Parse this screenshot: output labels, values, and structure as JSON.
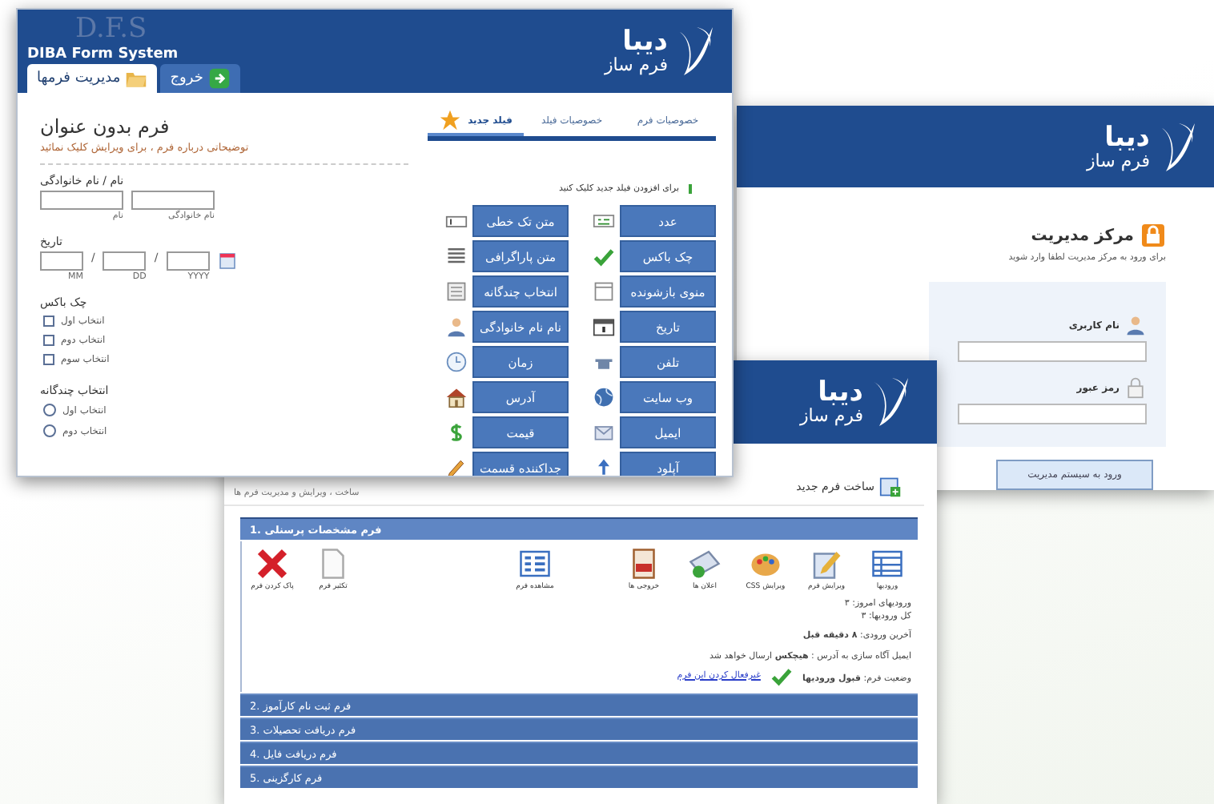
{
  "form_editor": {
    "brand": "D.F.S",
    "product_name": "DIBA Form System",
    "logo": {
      "name": "دیبا",
      "tagline": "فرم ساز"
    },
    "tabs": [
      {
        "label": "خروج",
        "selected": false
      },
      {
        "label": "مدیریت فرمها",
        "selected": true
      }
    ],
    "form": {
      "title": "فرم بدون عنوان",
      "description": "توضیحاتی درباره فرم ، برای ویرایش کلیک نمائید",
      "fields": [
        {
          "kind": "name",
          "label": "نام / نام خانوادگی",
          "sublabels": [
            "نام خانوادگی",
            "نام"
          ]
        },
        {
          "kind": "date",
          "label": "تاریخ",
          "sublabels": [
            "YYYY",
            "DD",
            "MM"
          ],
          "separators": [
            "/",
            "/"
          ]
        },
        {
          "kind": "checkbox",
          "label": "چک باکس",
          "options": [
            {
              "label": "انتخاب اول",
              "checked": false
            },
            {
              "label": "انتخاب دوم",
              "checked": false
            },
            {
              "label": "انتخاب سوم",
              "checked": false
            }
          ]
        },
        {
          "kind": "radio",
          "label": "انتخاب چندگانه",
          "options": [
            {
              "label": "انتخاب اول",
              "selected": false
            },
            {
              "label": "انتخاب دوم",
              "selected": false
            }
          ]
        }
      ]
    },
    "panel_tabs": [
      {
        "label": "خصوصیات فرم",
        "selected": false
      },
      {
        "label": "خصوصیات فیلد",
        "selected": false
      },
      {
        "label": "فیلد جدید",
        "selected": true
      }
    ],
    "add_field_hint": "برای افزودن فیلد جدید کلیک کنید",
    "field_buttons": [
      "عدد",
      "متن تک خطی",
      "چک باکس",
      "متن پاراگرافی",
      "منوی بازشونده",
      "انتخاب چندگانه",
      "تاریخ",
      "نام نام خانوادگی",
      "تلفن",
      "زمان",
      "وب سایت",
      "آدرس",
      "ایمیل",
      "قیمت",
      "آپلود",
      "جداکننده قسمت"
    ]
  },
  "login": {
    "logo": {
      "name": "دیبا",
      "tagline": "فرم ساز"
    },
    "title": "مرکز مدیریت",
    "subtitle": "برای ورود به مرکز مدیریت لطفا وارد شوید",
    "username_label": "نام کاربری",
    "password_label": "رمز عبور",
    "submit": "ورود به سیستم مدیریت"
  },
  "forms_list": {
    "logo": {
      "name": "دیبا",
      "tagline": "فرم ساز"
    },
    "new_form": "ساخت فرم جدید",
    "breadcrumb": "ساخت ، ویرایش و مدیریت فرم ها",
    "forms": [
      {
        "title": "1. فرم مشخصات پرسنلی",
        "expanded": true,
        "details": {
          "toolbar": [
            "ورودیها",
            "ویرایش فرم",
            "ویرایش CSS",
            "اعلان ها",
            "خروجی ها",
            "مشاهده فرم",
            "تکثیر فرم",
            "پاک کردن فرم"
          ],
          "stats": [
            "ورودیهای امروز: ۳",
            "کل ورودیها: ۳"
          ],
          "last_entry": "آخرین ورودی: **۸ دقیقه قبل**",
          "notification": "ایمیل آگاه سازی به آدرس : **هیچکس** ارسال خواهد شد",
          "status": "وضعیت فرم: **قبول ورودیها**",
          "disable_link": "غیرفعال کردن این فرم"
        }
      },
      {
        "title": "2. فرم ثبت نام کارآموز",
        "expanded": false
      },
      {
        "title": "3. فرم دریافت تحصیلات",
        "expanded": false
      },
      {
        "title": "4. فرم دریافت فایل",
        "expanded": false
      },
      {
        "title": "5. فرم کارگزینی",
        "expanded": false
      }
    ]
  }
}
